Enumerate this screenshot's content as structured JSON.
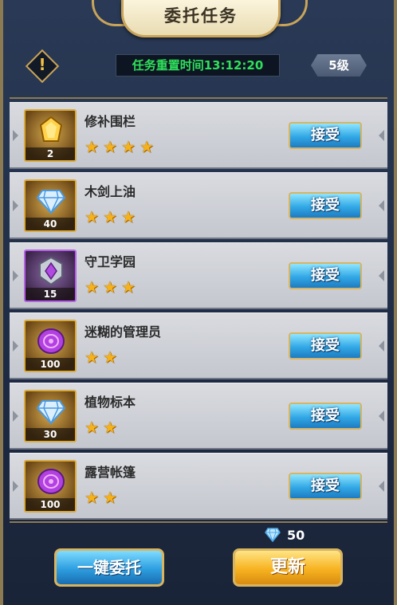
{
  "title": "委托任务",
  "reset_text": "任务重置时间13:12:20",
  "level_badge": "5级",
  "tasks": [
    {
      "name": "修补围栏",
      "stars": 4,
      "reward_qty": "2",
      "reward_icon": "gold-gem-icon",
      "accept_label": "接受"
    },
    {
      "name": "木剑上油",
      "stars": 3,
      "reward_qty": "40",
      "reward_icon": "diamond-icon",
      "accept_label": "接受"
    },
    {
      "name": "守卫学园",
      "stars": 3,
      "reward_qty": "15",
      "reward_icon": "purple-crest-icon",
      "accept_label": "接受"
    },
    {
      "name": "迷糊的管理员",
      "stars": 2,
      "reward_qty": "100",
      "reward_icon": "purple-coin-icon",
      "accept_label": "接受"
    },
    {
      "name": "植物标本",
      "stars": 2,
      "reward_qty": "30",
      "reward_icon": "diamond-icon",
      "accept_label": "接受"
    },
    {
      "name": "露营帐篷",
      "stars": 2,
      "reward_qty": "100",
      "reward_icon": "purple-coin-icon",
      "accept_label": "接受"
    }
  ],
  "diamond_count": "50",
  "buttons": {
    "delegate_all": "一键委托",
    "refresh": "更新"
  }
}
